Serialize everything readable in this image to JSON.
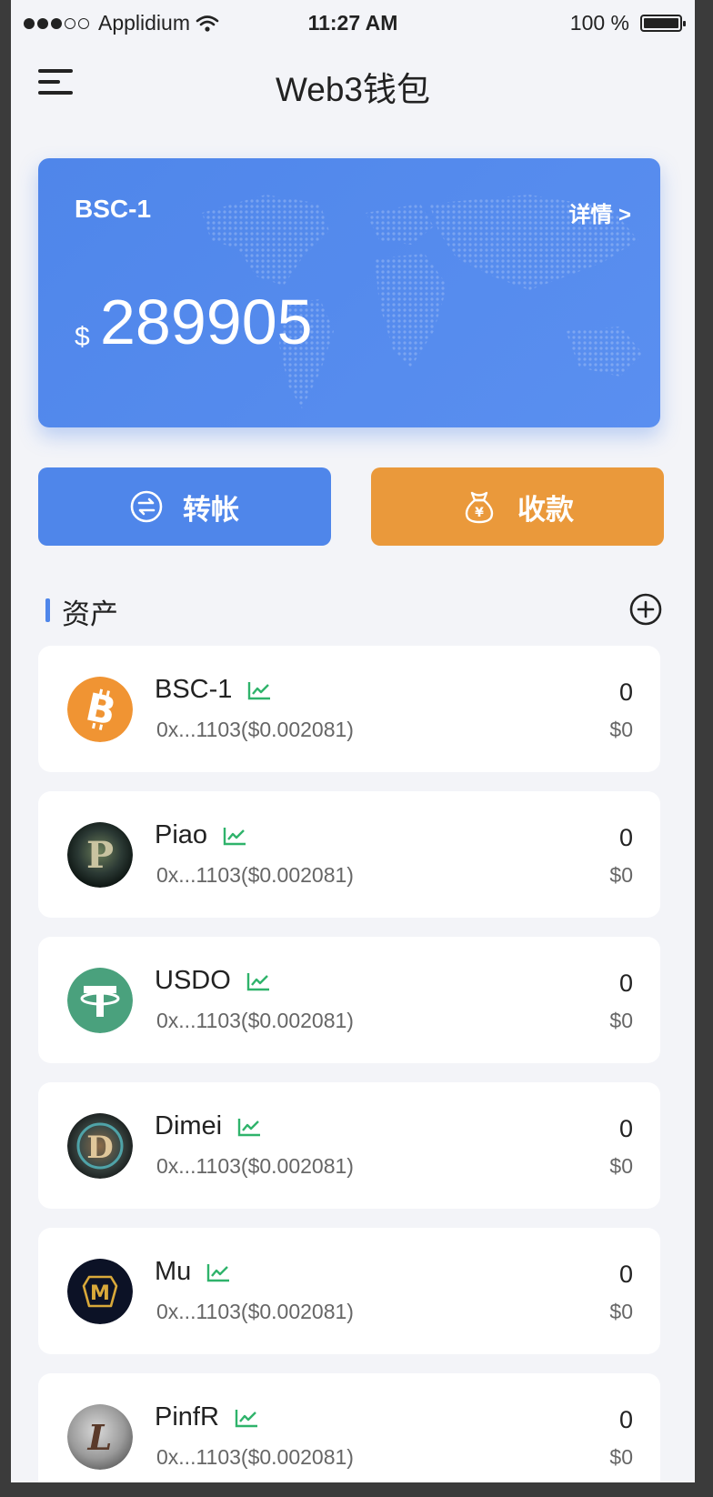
{
  "status_bar": {
    "carrier": "Applidium",
    "time": "11:27 AM",
    "battery": "100 %"
  },
  "nav": {
    "title": "Web3钱包"
  },
  "wallet_card": {
    "name": "BSC-1",
    "detail_link": "详情 >",
    "currency_symbol": "$",
    "balance": "289905"
  },
  "actions": {
    "transfer": "转帐",
    "receive": "收款"
  },
  "assets_section": {
    "title": "资产",
    "items": [
      {
        "name": "BSC-1",
        "address": "0x...1103($0.002081)",
        "amount": "0",
        "value": "$0",
        "icon": "bitcoin-icon"
      },
      {
        "name": "Piao",
        "address": "0x...1103($0.002081)",
        "amount": "0",
        "value": "$0",
        "icon": "piao-token-icon"
      },
      {
        "name": "USDO",
        "address": "0x...1103($0.002081)",
        "amount": "0",
        "value": "$0",
        "icon": "tether-icon"
      },
      {
        "name": "Dimei",
        "address": "0x...1103($0.002081)",
        "amount": "0",
        "value": "$0",
        "icon": "dimei-token-icon"
      },
      {
        "name": "Mu",
        "address": "0x...1103($0.002081)",
        "amount": "0",
        "value": "$0",
        "icon": "mu-token-icon"
      },
      {
        "name": "PinfR",
        "address": "0x...1103($0.002081)",
        "amount": "0",
        "value": "$0",
        "icon": "pinfr-token-icon"
      }
    ]
  },
  "colors": {
    "primary": "#4f86ea",
    "receive": "#ea993b",
    "trend": "#2fb36b",
    "background": "#f3f4f8"
  }
}
